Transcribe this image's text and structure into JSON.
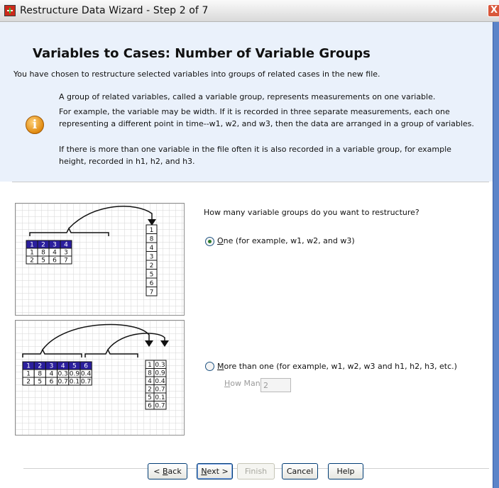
{
  "window": {
    "title": "Restructure Data Wizard - Step 2 of 7",
    "close_glyph": "X"
  },
  "header": {
    "heading": "Variables to Cases: Number of Variable Groups",
    "intro": "You have chosen to restructure selected variables into groups of related cases in the new file.",
    "para1": "A group of related variables, called a variable group, represents measurements on one variable.",
    "para2": "For example, the variable may be width.  If it is recorded in three separate measurements, each one representing a different point in time--w1, w2, and w3, then the data are arranged in a group of variables.",
    "para3": "If there is more than one variable in the file often it is also recorded in a variable group, for example height, recorded in h1, h2, and h3.",
    "info_glyph": "i"
  },
  "illustration_one": {
    "header_row": [
      "1",
      "2",
      "3",
      "4"
    ],
    "rows": [
      [
        "1",
        "8",
        "4",
        "3"
      ],
      [
        "2",
        "5",
        "6",
        "7"
      ]
    ],
    "result_column": [
      "1",
      "8",
      "4",
      "3",
      "2",
      "5",
      "6",
      "7"
    ]
  },
  "illustration_many": {
    "header_row": [
      "1",
      "2",
      "3",
      "4",
      "5",
      "6"
    ],
    "rows": [
      [
        "1",
        "8",
        "4",
        "0.3",
        "0.9",
        "0.4"
      ],
      [
        "2",
        "5",
        "6",
        "0.7",
        "0.1",
        "0.7"
      ]
    ],
    "result_left": [
      "1",
      "8",
      "4",
      "2",
      "5",
      "6"
    ],
    "result_right": [
      "0.3",
      "0.9",
      "0.4",
      "0.7",
      "0.1",
      "0.7"
    ]
  },
  "question": "How many variable groups do you want to restructure?",
  "options": {
    "one": {
      "mnemonic": "O",
      "rest": "ne (for example, w1, w2, and w3)",
      "selected": true
    },
    "more": {
      "mnemonic": "M",
      "rest": "ore than one (for example, w1, w2, w3 and h1, h2, h3, etc.)",
      "selected": false
    }
  },
  "how_many": {
    "mnemonic": "H",
    "rest": "ow Many?",
    "value": "2"
  },
  "buttons": {
    "back": {
      "prefix": "< ",
      "mnemonic": "B",
      "rest": "ack"
    },
    "next": {
      "mnemonic": "N",
      "rest": "ext >"
    },
    "finish": {
      "label": "Finish"
    },
    "cancel": {
      "label": "Cancel"
    },
    "help": {
      "label": "Help"
    }
  },
  "colors": {
    "header_bg": "#eaf1fb",
    "table_header_bg": "#2b1f9e",
    "grid_line": "#d6d6d6"
  }
}
